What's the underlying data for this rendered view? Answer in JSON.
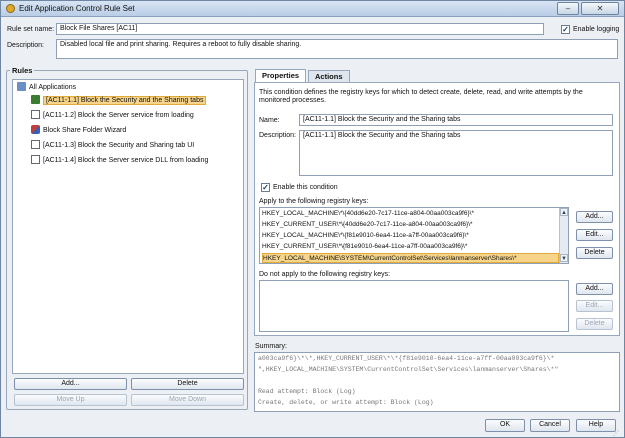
{
  "window": {
    "title": "Edit Application Control Rule Set"
  },
  "ruleset": {
    "name_label": "Rule set name:",
    "name_value": "Block File Shares [AC11]",
    "enable_logging_label": "Enable logging",
    "enable_logging_checked": true,
    "description_label": "Description:",
    "description_value": "Disabled local file and print sharing.  Requires a reboot to fully disable sharing."
  },
  "rules": {
    "title": "Rules",
    "root": "All Applications",
    "items": [
      {
        "label": "[AC11-1.1] Block the Security and the Sharing tabs",
        "icon": "rule-icon",
        "selected": true
      },
      {
        "label": "[AC11-1.2] Block the Server service from loading",
        "icon": "document-icon",
        "selected": false
      },
      {
        "label": "Block Share Folder Wizard",
        "icon": "key-icon",
        "selected": false
      },
      {
        "label": "[AC11-1.3] Block the Security and Sharing tab UI",
        "icon": "document-icon",
        "selected": false
      },
      {
        "label": "[AC11-1.4] Block the Server service DLL from loading",
        "icon": "document-icon",
        "selected": false
      }
    ],
    "buttons": {
      "add": "Add...",
      "delete": "Delete",
      "move_up": "Move Up",
      "move_down": "Move Down"
    }
  },
  "tabs": [
    {
      "label": "Properties",
      "active": true
    },
    {
      "label": "Actions",
      "active": false
    }
  ],
  "properties": {
    "intro": "This condition defines the registry keys for which to detect create, delete, read, and write attempts by the monitored processes.",
    "name_label": "Name:",
    "name_value": "[AC11-1.1] Block the Security and the Sharing tabs",
    "description_label": "Description:",
    "description_value": "[AC11-1.1] Block the Security and the Sharing tabs",
    "enable_condition_label": "Enable this condition",
    "enable_condition_checked": true,
    "apply_label": "Apply to the following registry keys:",
    "apply_keys": [
      "HKEY_LOCAL_MACHINE\\*\\{40dd6e20-7c17-11ce-a804-00aa003ca9f6}\\*",
      "HKEY_CURRENT_USER\\*\\{40dd6e20-7c17-11ce-a804-00aa003ca9f6}\\*",
      "HKEY_LOCAL_MACHINE\\*\\{f81e9010-6ea4-11ce-a7ff-00aa003ca9f6}\\*",
      "HKEY_CURRENT_USER\\*\\{f81e9010-6ea4-11ce-a7ff-00aa003ca9f6}\\*",
      "HKEY_LOCAL_MACHINE\\SYSTEM\\CurrentControlSet\\Services\\lanmanserver\\Shares\\*"
    ],
    "apply_selected_index": 4,
    "apply_buttons": {
      "add": "Add...",
      "edit": "Edit...",
      "delete": "Delete"
    },
    "exclude_label": "Do not apply to the following registry keys:",
    "exclude_buttons": {
      "add": "Add...",
      "edit": "Edit...",
      "delete": "Delete"
    }
  },
  "summary": {
    "label": "Summary:",
    "lines": [
      "a003ca9f6}\\*\\*,HKEY_CURRENT_USER\\*\\*{f81e9010-6ea4-11ce-a7ff-00aa003ca9f6}\\*",
      "\",HKEY_LOCAL_MACHINE\\SYSTEM\\CurrentControlSet\\Services\\lanmanserver\\Shares\\*\"",
      "",
      "Read attempt:                    Block (Log)",
      "Create, delete, or write attempt:   Block (Log)"
    ]
  },
  "footer": {
    "ok": "OK",
    "cancel": "Cancel",
    "help": "Help"
  }
}
